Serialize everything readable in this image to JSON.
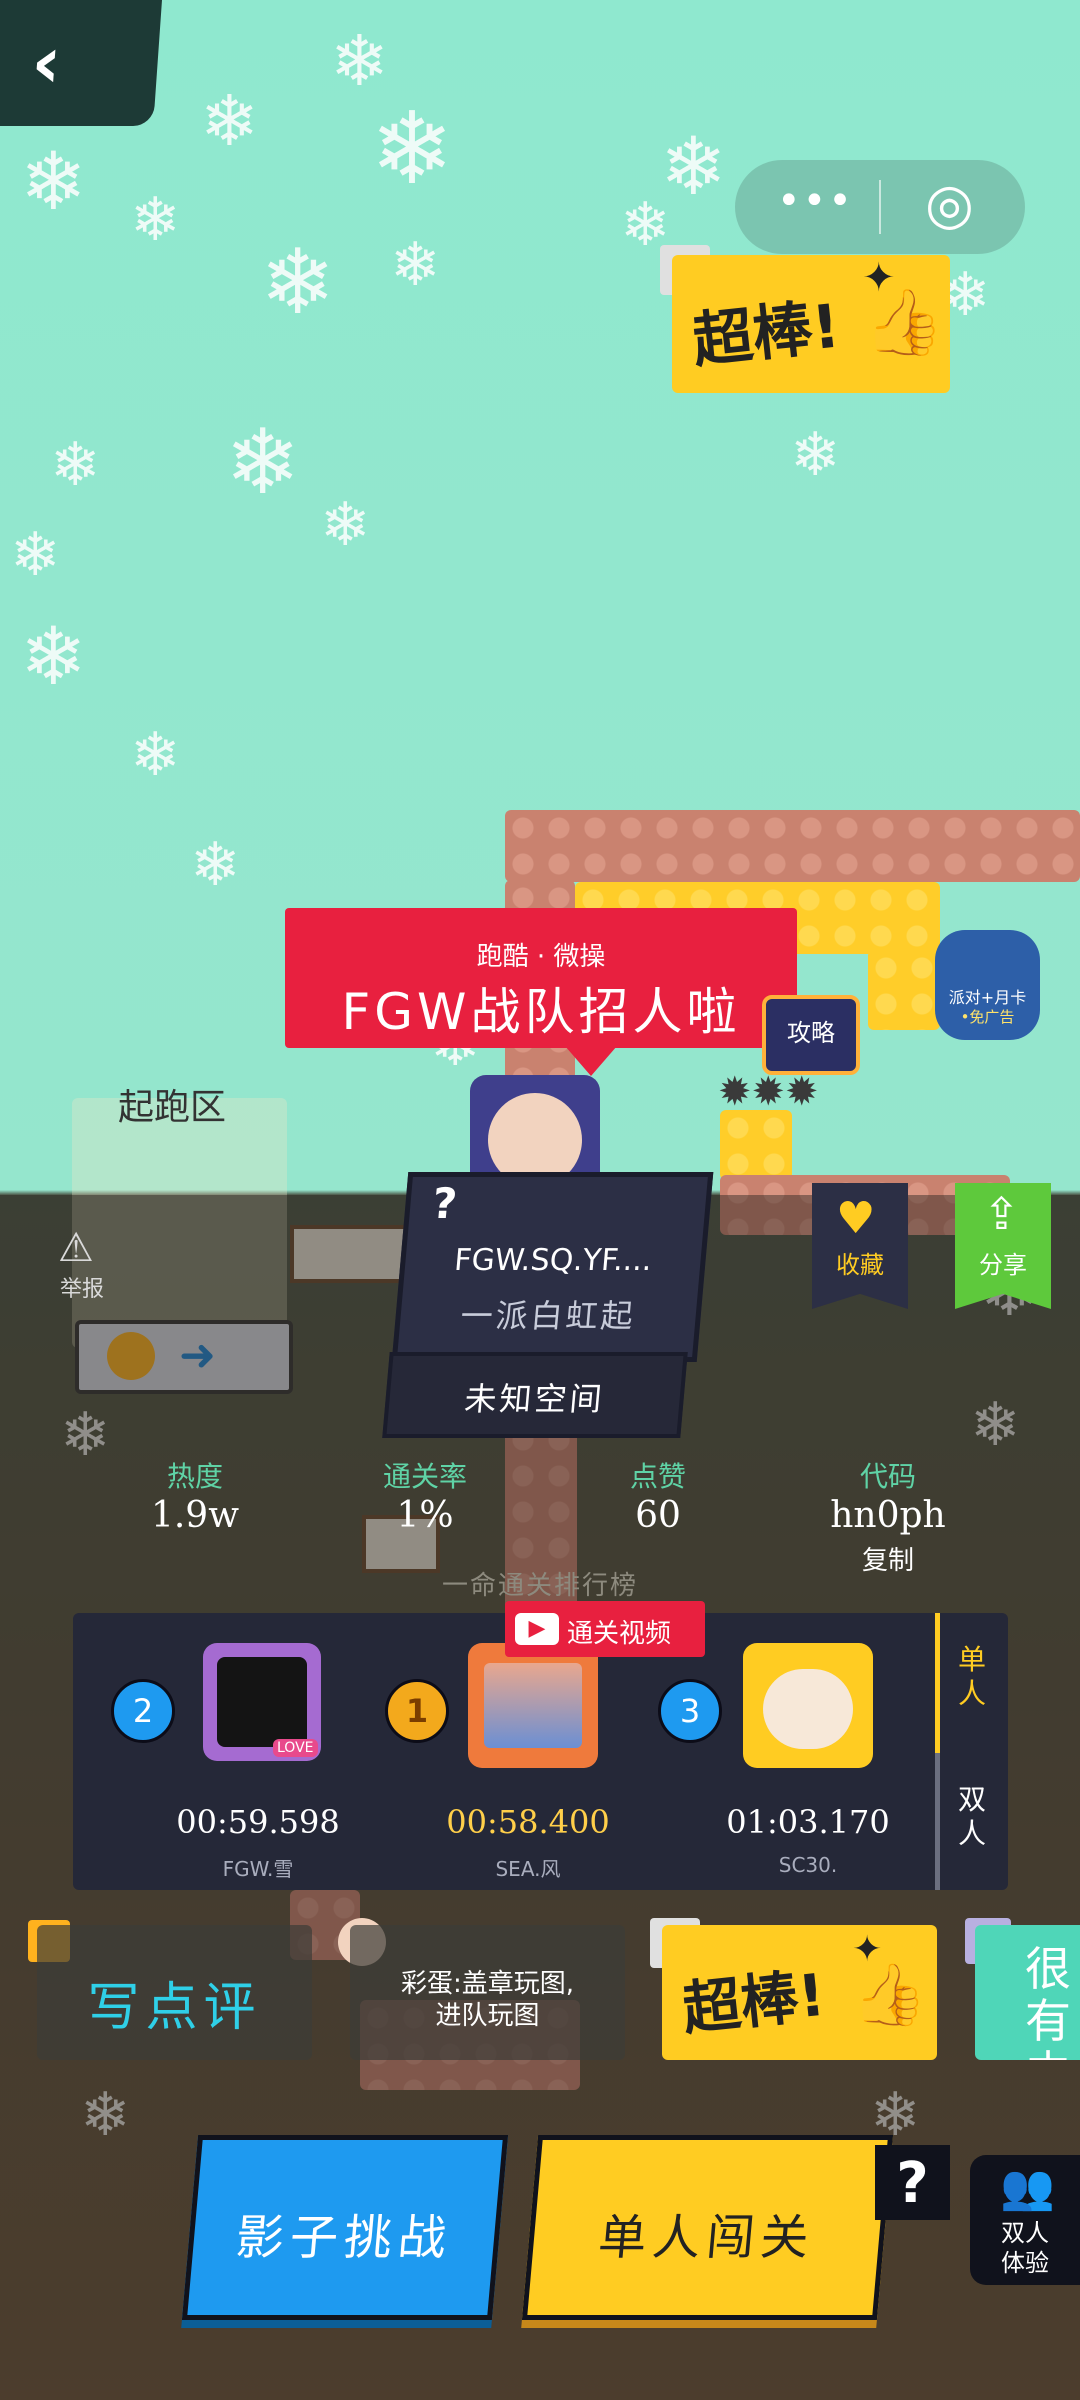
{
  "nav": {
    "back_label": "<",
    "capsule_more": "•••",
    "capsule_close": "◎"
  },
  "praise": {
    "text": "超棒!"
  },
  "level": {
    "banner_sub": "跑酷 · 微操",
    "banner_title": "FGW战队招人啦",
    "guide_label": "攻略",
    "promo_label": "派对+月卡",
    "promo_sub": "•免广告",
    "start_zone": "起跑区",
    "report_label": "举报",
    "name": "FGW.SQ.YF....",
    "subtitle": "一派白虹起",
    "space": "未知空间",
    "question_mark": "?"
  },
  "actions": {
    "favorite_label": "收藏",
    "share_label": "分享"
  },
  "stats": {
    "heat_label": "热度",
    "heat_value": "1.9w",
    "clear_rate_label": "通关率",
    "clear_rate_value": "1%",
    "likes_label": "点赞",
    "likes_value": "60",
    "code_label": "代码",
    "code_value": "hn0ph",
    "copy_label": "复制"
  },
  "leaderboard": {
    "title": "一命通关排行榜",
    "video_label": "通关视频",
    "tab_single": "单人",
    "tab_double": "双人",
    "entries": [
      {
        "rank": "2",
        "time": "00:59.598",
        "name": "FGW.雪"
      },
      {
        "rank": "1",
        "time": "00:58.400",
        "name": "SEA.风"
      },
      {
        "rank": "3",
        "time": "01:03.170",
        "name": "SC30."
      }
    ],
    "love_text": "LOVE"
  },
  "comments": {
    "write_review": "写点评",
    "easter_egg_line1": "彩蛋:盖章玩图,",
    "easter_egg_line2": "进队玩图",
    "praise": "超棒!",
    "partial": "很有内"
  },
  "buttons": {
    "shadow_challenge": "影子挑战",
    "single_play": "单人闯关",
    "help": "?",
    "duo_line1": "双人",
    "duo_line2": "体验"
  },
  "colors": {
    "background_top": "#8fe8cf",
    "banner_red": "#e8203f",
    "accent_yellow": "#ffcc22",
    "accent_blue": "#1e9af0",
    "share_green": "#5ec93c",
    "stat_label_green": "#5fd3a6",
    "time_gold": "#ffcf4a"
  }
}
